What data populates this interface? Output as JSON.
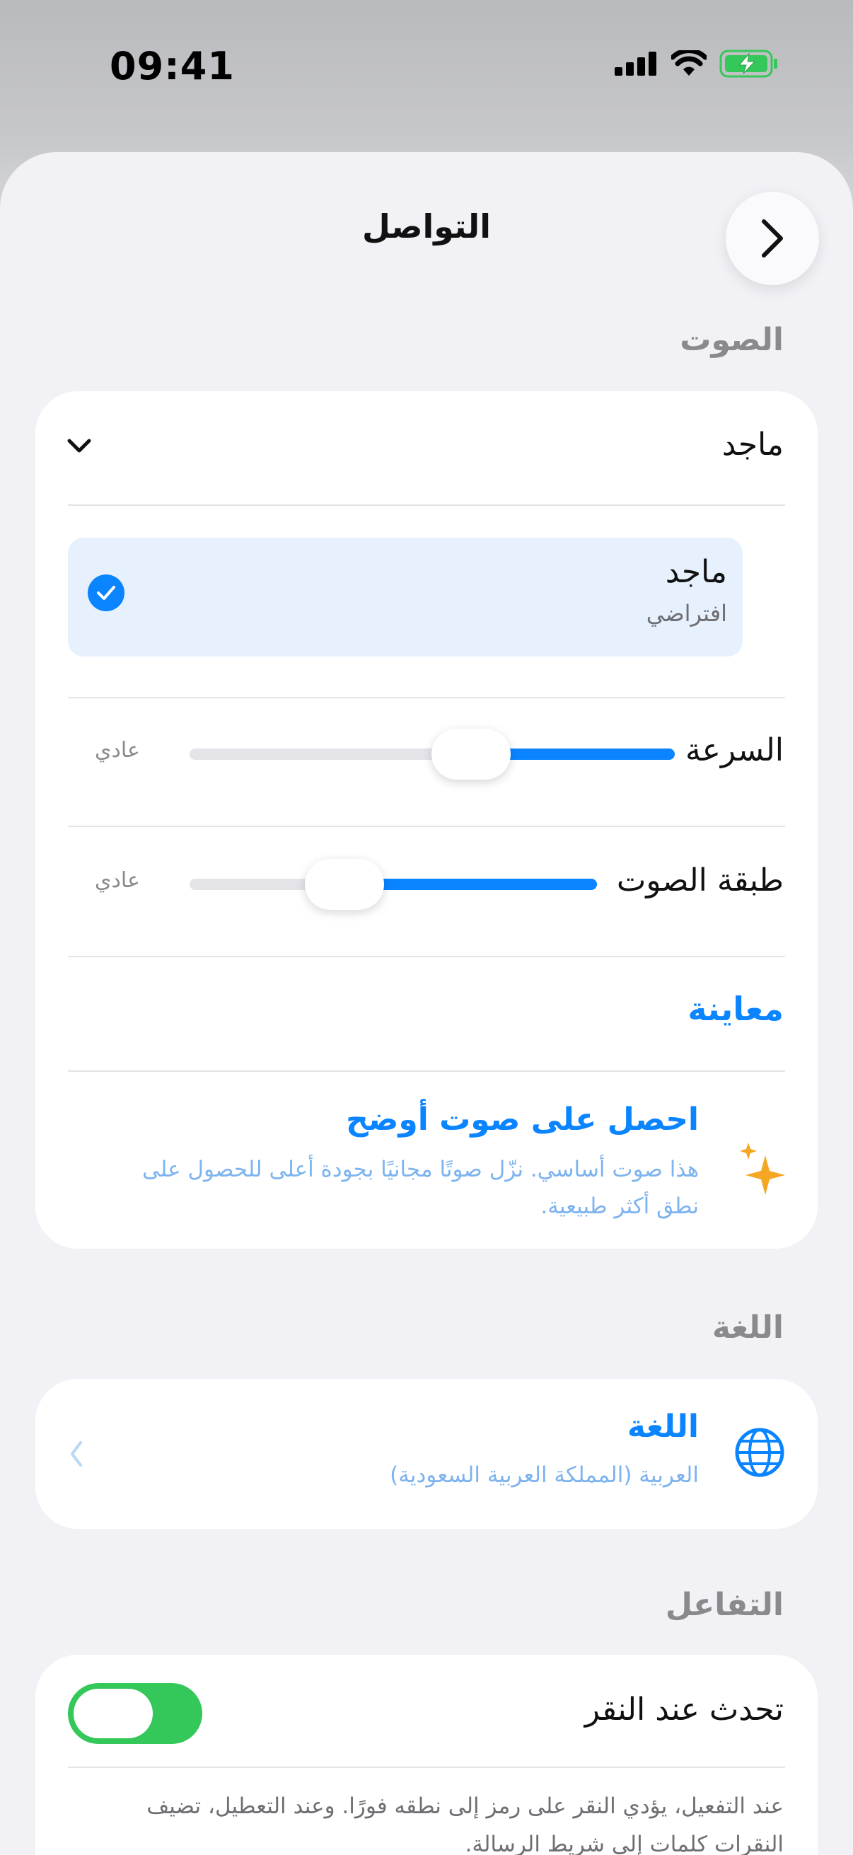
{
  "status_bar": {
    "time": "09:41"
  },
  "header": {
    "title": "التواصل"
  },
  "voice_section": {
    "label": "الصوت",
    "selected_voice": "ماجد",
    "option": {
      "name": "ماجد",
      "subtitle": "افتراضي"
    },
    "speed": {
      "label": "السرعة",
      "value_label": "عادي",
      "level": 0.42
    },
    "pitch": {
      "label": "طبقة الصوت",
      "value_label": "عادي",
      "level": 0.62
    },
    "preview_label": "معاينة",
    "upgrade": {
      "title": "احصل على صوت أوضح",
      "line1": "هذا صوت أساسي. نزّل صوتًا مجانيًا بجودة أعلى للحصول على",
      "line2": "نطق أكثر طبيعية."
    }
  },
  "language_section": {
    "label": "اللغة",
    "item_title": "اللغة",
    "item_value": "العربية (المملكة العربية السعودية)"
  },
  "interaction_section": {
    "label": "التفاعل",
    "tap_to_speak_label": "تحدث عند النقر",
    "tap_to_speak_on": true,
    "description_line1": "عند التفعيل، يؤدي النقر على رمز إلى نطقه فورًا. وعند التعطيل، تضيف",
    "description_line2": "النقرات كلمات إلى شريط الرسالة."
  },
  "colors": {
    "accent": "#0a84ff",
    "toggle_on": "#34c759",
    "sparkle": "#f5a623"
  }
}
